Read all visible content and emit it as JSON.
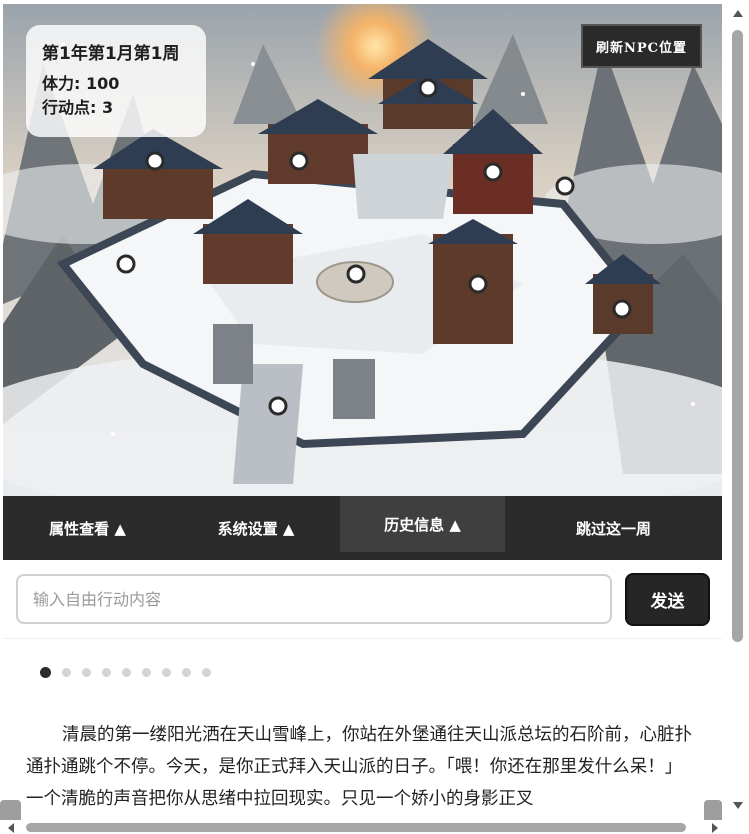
{
  "hud": {
    "date": "第1年第1月第1周",
    "stamina": "体力: 100",
    "action_points": "行动点: 3"
  },
  "refresh_button": "刷新NPC位置",
  "map": {
    "description_icon": "snowy-mountain-sect-map",
    "npc_markers": 11
  },
  "nav": {
    "tabs": [
      {
        "label": "属性查看 ▲"
      },
      {
        "label": "系统设置 ▲"
      },
      {
        "label": "历史信息 ▲"
      },
      {
        "label": "跳过这一周"
      }
    ],
    "active_index": 2
  },
  "action_input": {
    "placeholder": "输入自由行动内容",
    "value": ""
  },
  "send_button": "发送",
  "story": {
    "page_count": 9,
    "current_page": 1,
    "text": "清晨的第一缕阳光洒在天山雪峰上，你站在外堡通往天山派总坛的石阶前，心脏扑通扑通跳个不停。今天，是你正式拜入天山派的日子。「喂！你还在那里发什么呆！」一个清脆的声音把你从思绪中拉回现实。只见一个娇小的身影正叉"
  },
  "colors": {
    "dark_bar": "#2b2b2b",
    "active_tab": "#3f3f3f",
    "send_bg": "#262626"
  }
}
